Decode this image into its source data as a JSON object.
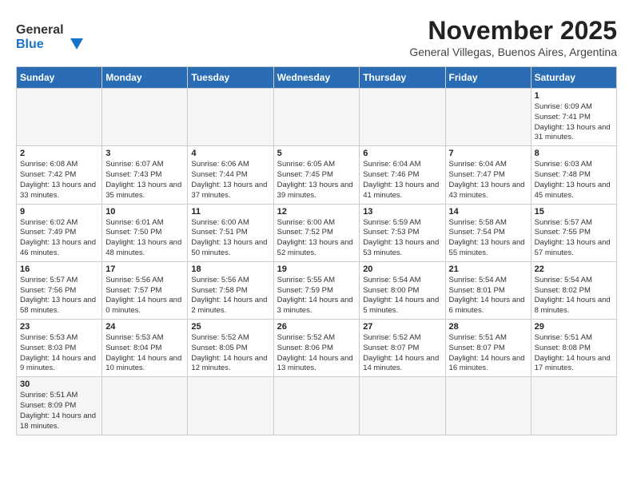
{
  "header": {
    "logo_general": "General",
    "logo_blue": "Blue",
    "month_title": "November 2025",
    "subtitle": "General Villegas, Buenos Aires, Argentina"
  },
  "weekdays": [
    "Sunday",
    "Monday",
    "Tuesday",
    "Wednesday",
    "Thursday",
    "Friday",
    "Saturday"
  ],
  "weeks": [
    [
      {
        "day": "",
        "info": ""
      },
      {
        "day": "",
        "info": ""
      },
      {
        "day": "",
        "info": ""
      },
      {
        "day": "",
        "info": ""
      },
      {
        "day": "",
        "info": ""
      },
      {
        "day": "",
        "info": ""
      },
      {
        "day": "1",
        "info": "Sunrise: 6:09 AM\nSunset: 7:41 PM\nDaylight: 13 hours and 31 minutes."
      }
    ],
    [
      {
        "day": "2",
        "info": "Sunrise: 6:08 AM\nSunset: 7:42 PM\nDaylight: 13 hours and 33 minutes."
      },
      {
        "day": "3",
        "info": "Sunrise: 6:07 AM\nSunset: 7:43 PM\nDaylight: 13 hours and 35 minutes."
      },
      {
        "day": "4",
        "info": "Sunrise: 6:06 AM\nSunset: 7:44 PM\nDaylight: 13 hours and 37 minutes."
      },
      {
        "day": "5",
        "info": "Sunrise: 6:05 AM\nSunset: 7:45 PM\nDaylight: 13 hours and 39 minutes."
      },
      {
        "day": "6",
        "info": "Sunrise: 6:04 AM\nSunset: 7:46 PM\nDaylight: 13 hours and 41 minutes."
      },
      {
        "day": "7",
        "info": "Sunrise: 6:04 AM\nSunset: 7:47 PM\nDaylight: 13 hours and 43 minutes."
      },
      {
        "day": "8",
        "info": "Sunrise: 6:03 AM\nSunset: 7:48 PM\nDaylight: 13 hours and 45 minutes."
      }
    ],
    [
      {
        "day": "9",
        "info": "Sunrise: 6:02 AM\nSunset: 7:49 PM\nDaylight: 13 hours and 46 minutes."
      },
      {
        "day": "10",
        "info": "Sunrise: 6:01 AM\nSunset: 7:50 PM\nDaylight: 13 hours and 48 minutes."
      },
      {
        "day": "11",
        "info": "Sunrise: 6:00 AM\nSunset: 7:51 PM\nDaylight: 13 hours and 50 minutes."
      },
      {
        "day": "12",
        "info": "Sunrise: 6:00 AM\nSunset: 7:52 PM\nDaylight: 13 hours and 52 minutes."
      },
      {
        "day": "13",
        "info": "Sunrise: 5:59 AM\nSunset: 7:53 PM\nDaylight: 13 hours and 53 minutes."
      },
      {
        "day": "14",
        "info": "Sunrise: 5:58 AM\nSunset: 7:54 PM\nDaylight: 13 hours and 55 minutes."
      },
      {
        "day": "15",
        "info": "Sunrise: 5:57 AM\nSunset: 7:55 PM\nDaylight: 13 hours and 57 minutes."
      }
    ],
    [
      {
        "day": "16",
        "info": "Sunrise: 5:57 AM\nSunset: 7:56 PM\nDaylight: 13 hours and 58 minutes."
      },
      {
        "day": "17",
        "info": "Sunrise: 5:56 AM\nSunset: 7:57 PM\nDaylight: 14 hours and 0 minutes."
      },
      {
        "day": "18",
        "info": "Sunrise: 5:56 AM\nSunset: 7:58 PM\nDaylight: 14 hours and 2 minutes."
      },
      {
        "day": "19",
        "info": "Sunrise: 5:55 AM\nSunset: 7:59 PM\nDaylight: 14 hours and 3 minutes."
      },
      {
        "day": "20",
        "info": "Sunrise: 5:54 AM\nSunset: 8:00 PM\nDaylight: 14 hours and 5 minutes."
      },
      {
        "day": "21",
        "info": "Sunrise: 5:54 AM\nSunset: 8:01 PM\nDaylight: 14 hours and 6 minutes."
      },
      {
        "day": "22",
        "info": "Sunrise: 5:54 AM\nSunset: 8:02 PM\nDaylight: 14 hours and 8 minutes."
      }
    ],
    [
      {
        "day": "23",
        "info": "Sunrise: 5:53 AM\nSunset: 8:03 PM\nDaylight: 14 hours and 9 minutes."
      },
      {
        "day": "24",
        "info": "Sunrise: 5:53 AM\nSunset: 8:04 PM\nDaylight: 14 hours and 10 minutes."
      },
      {
        "day": "25",
        "info": "Sunrise: 5:52 AM\nSunset: 8:05 PM\nDaylight: 14 hours and 12 minutes."
      },
      {
        "day": "26",
        "info": "Sunrise: 5:52 AM\nSunset: 8:06 PM\nDaylight: 14 hours and 13 minutes."
      },
      {
        "day": "27",
        "info": "Sunrise: 5:52 AM\nSunset: 8:07 PM\nDaylight: 14 hours and 14 minutes."
      },
      {
        "day": "28",
        "info": "Sunrise: 5:51 AM\nSunset: 8:07 PM\nDaylight: 14 hours and 16 minutes."
      },
      {
        "day": "29",
        "info": "Sunrise: 5:51 AM\nSunset: 8:08 PM\nDaylight: 14 hours and 17 minutes."
      }
    ],
    [
      {
        "day": "30",
        "info": "Sunrise: 5:51 AM\nSunset: 8:09 PM\nDaylight: 14 hours and 18 minutes."
      },
      {
        "day": "",
        "info": ""
      },
      {
        "day": "",
        "info": ""
      },
      {
        "day": "",
        "info": ""
      },
      {
        "day": "",
        "info": ""
      },
      {
        "day": "",
        "info": ""
      },
      {
        "day": "",
        "info": ""
      }
    ]
  ]
}
